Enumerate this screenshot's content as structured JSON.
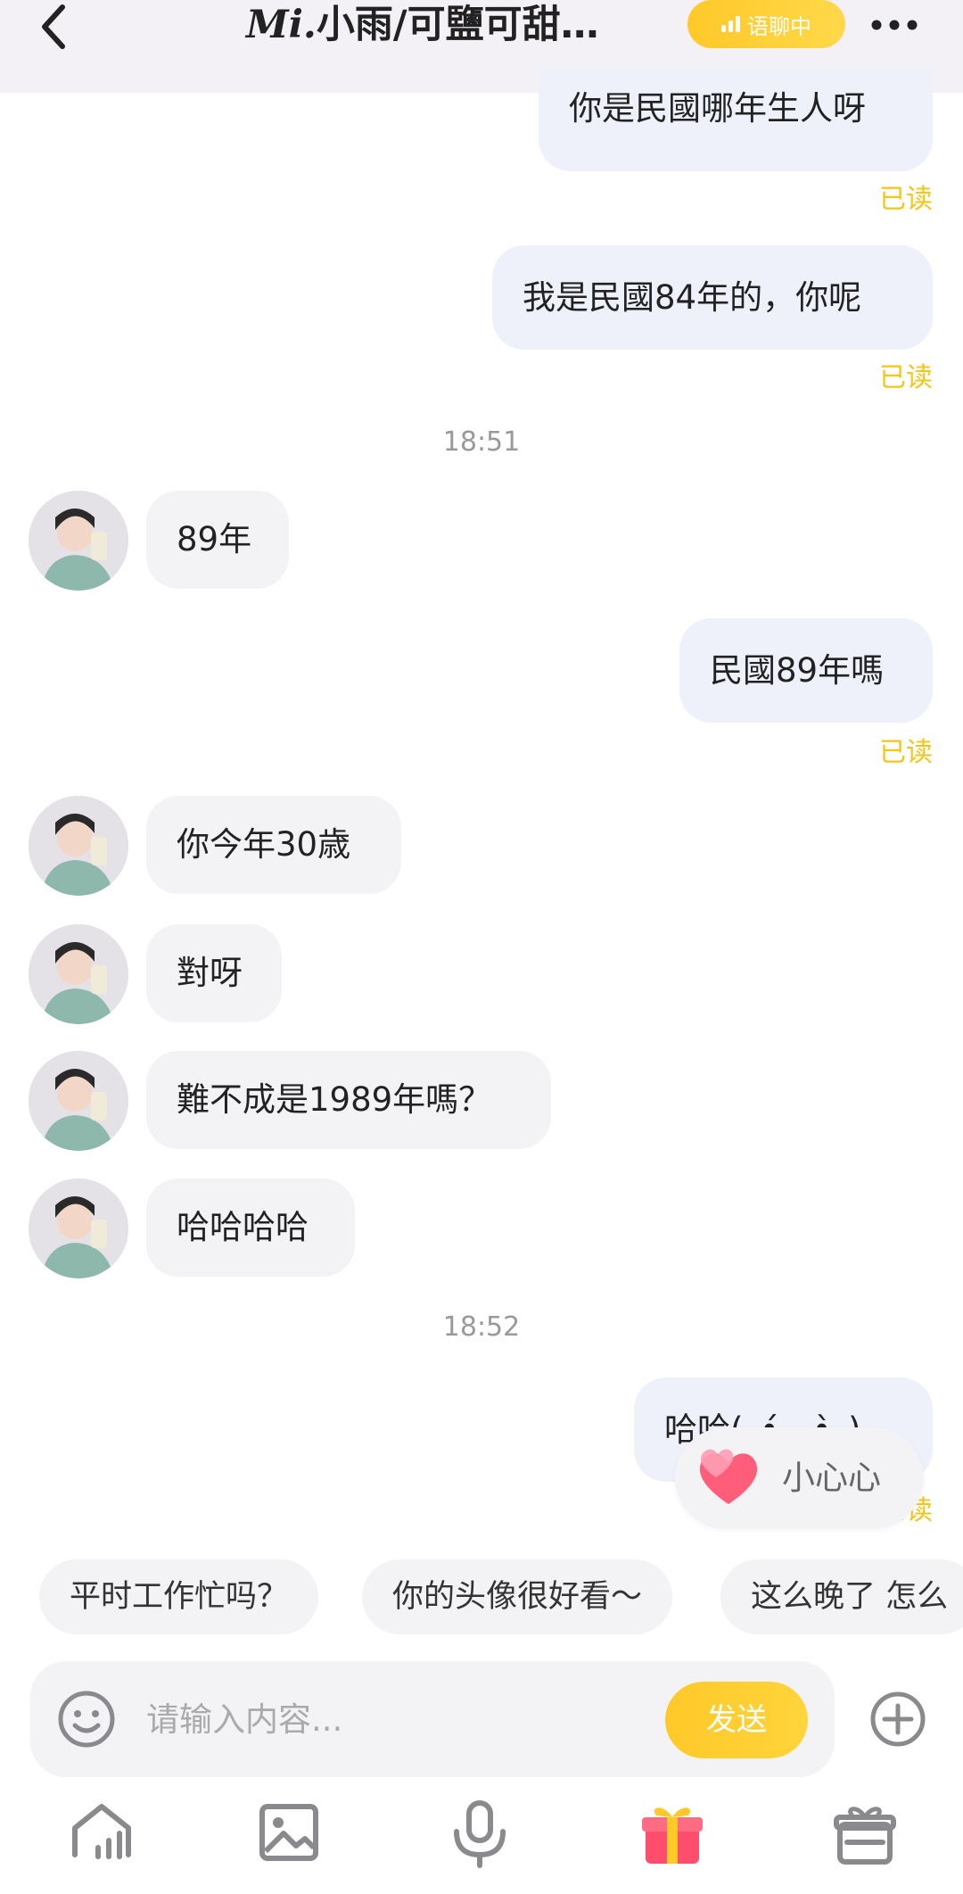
{
  "header": {
    "title_prefix": "Mi.",
    "title_rest": "小雨/可鹽可甜…",
    "voice_badge": "语聊中"
  },
  "messages": [
    {
      "side": "out",
      "text": "你是民國哪年生人呀",
      "status": "已读"
    },
    {
      "side": "out",
      "text": "我是民國84年的，你呢",
      "status": "已读"
    },
    {
      "type": "time",
      "text": "18:51"
    },
    {
      "side": "in",
      "text": "89年"
    },
    {
      "side": "out",
      "text": "民國89年嗎",
      "status": "已读"
    },
    {
      "side": "in",
      "text": "你今年30歳"
    },
    {
      "side": "in",
      "text": "對呀"
    },
    {
      "side": "in",
      "text": "難不成是1989年嗎？"
    },
    {
      "side": "in",
      "text": "哈哈哈哈"
    },
    {
      "type": "time",
      "text": "18:52"
    },
    {
      "side": "out",
      "text": "哈哈(｡•́︿•̀｡)",
      "status": "已读"
    }
  ],
  "floating_reaction": {
    "label": "小心心",
    "icon": "heart-icon"
  },
  "quick_replies": [
    "平时工作忙吗？",
    "你的头像很好看～",
    "这么晚了 怎么"
  ],
  "input": {
    "placeholder": "请输入内容...",
    "send_label": "发送"
  },
  "toolbar_icons": [
    "home-chart-icon",
    "image-icon",
    "microphone-icon",
    "gift-icon",
    "gift-box-icon"
  ],
  "colors": {
    "accent": "#FFC928",
    "outgoing_bubble": "#EEF0FA",
    "incoming_bubble": "#F3F3F6",
    "read_status": "#F5C518",
    "header_bg": "#F3F1F6"
  }
}
